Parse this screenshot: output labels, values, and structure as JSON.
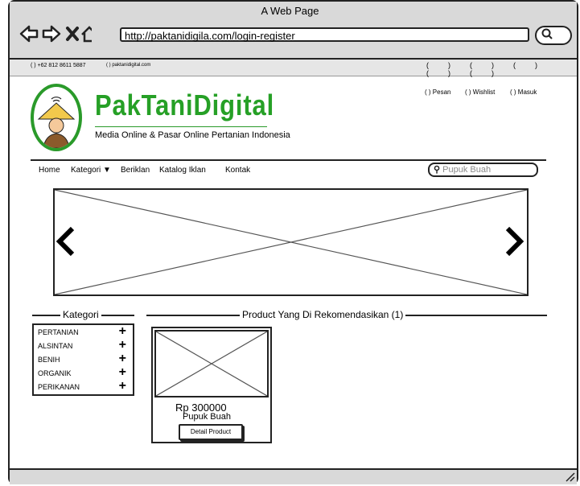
{
  "window": {
    "title": "A Web Page",
    "url": "http://paktanidigila.com/login-register"
  },
  "infobar": {
    "phone": "+62 812 8611 5887",
    "website": "paktanidigital.com"
  },
  "brand": {
    "name": "PakTaniDigital",
    "tagline": "Media Online & Pasar Online Pertanian Indonesia",
    "color": "#26a026"
  },
  "toplinks": {
    "pesan": "Pesan",
    "wishlist": "Wishlist",
    "masuk": "Masuk"
  },
  "menu": {
    "home": "Home",
    "kategori": "Kategori",
    "beriklan": "Beriklan",
    "katalog": "Katalog Iklan",
    "kontak": "Kontak"
  },
  "search": {
    "placeholder": "Pupuk Buah"
  },
  "sections": {
    "kategori": "Kategori",
    "recommended": "Product Yang Di Rekomendasikan (1)"
  },
  "categories": [
    "PERTANIAN",
    "ALSINTAN",
    "BENIH",
    "ORGANIK",
    "PERIKANAN"
  ],
  "products": [
    {
      "price": "Rp 300000",
      "name": "Pupuk Buah",
      "button": "Detail Product"
    }
  ],
  "icons": {
    "back": "back-arrow-icon",
    "forward": "forward-arrow-icon",
    "close": "close-icon",
    "home": "home-icon",
    "search": "search-icon",
    "prev": "chevron-left-icon",
    "next": "chevron-right-icon",
    "plus": "plus-icon"
  }
}
